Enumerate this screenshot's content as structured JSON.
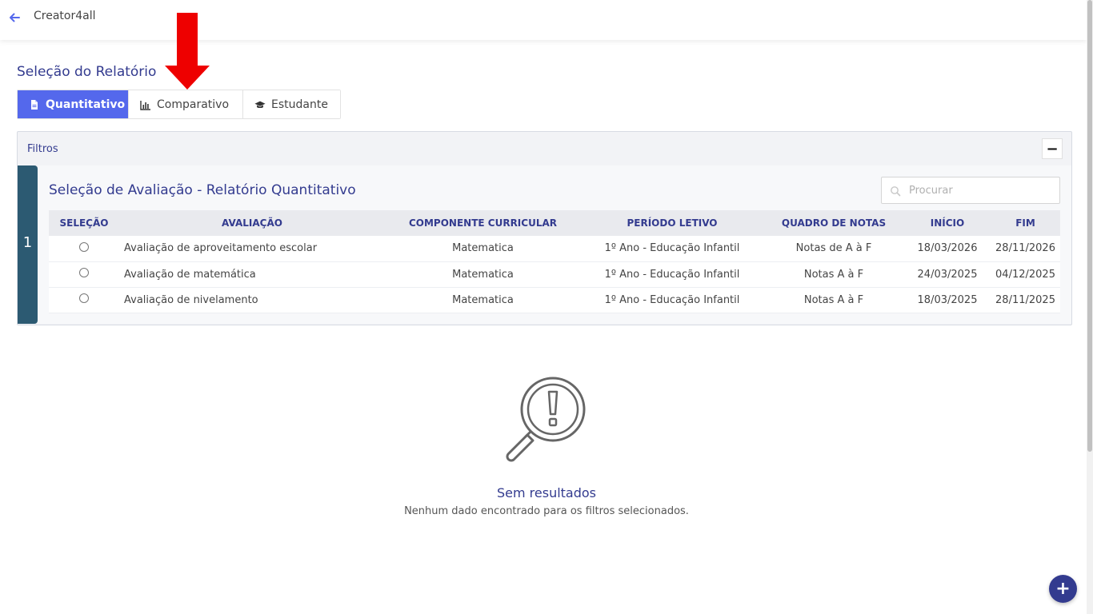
{
  "header": {
    "app_title": "Creator4all",
    "back_icon": "arrow-left-icon"
  },
  "page": {
    "section_title": "Seleção do Relatório"
  },
  "tabs": [
    {
      "label": "Quantitativo",
      "icon": "file-icon",
      "active": true
    },
    {
      "label": "Comparativo",
      "icon": "bar-chart-icon",
      "active": false
    },
    {
      "label": "Estudante",
      "icon": "graduation-cap-icon",
      "active": false
    }
  ],
  "filters": {
    "title": "Filtros",
    "collapse_label": "−",
    "step_number": "1",
    "subtitle": "Seleção de Avaliação - Relatório Quantitativo",
    "search_placeholder": "Procurar",
    "columns": [
      "SELEÇÃO",
      "AVALIAÇÃO",
      "COMPONENTE CURRICULAR",
      "PERÍODO LETIVO",
      "QUADRO DE NOTAS",
      "INÍCIO",
      "FIM"
    ],
    "rows": [
      {
        "avaliacao": "Avaliação de aproveitamento escolar",
        "componente": "Matematica",
        "periodo": "1º Ano - Educação Infantil",
        "quadro": "Notas de A à F",
        "inicio": "18/03/2026",
        "fim": "28/11/2026"
      },
      {
        "avaliacao": "Avaliação de matemática",
        "componente": "Matematica",
        "periodo": "1º Ano - Educação Infantil",
        "quadro": "Notas A à F",
        "inicio": "24/03/2025",
        "fim": "04/12/2025"
      },
      {
        "avaliacao": "Avaliação de nivelamento",
        "componente": "Matematica",
        "periodo": "1º Ano - Educação Infantil",
        "quadro": "Notas A à F",
        "inicio": "18/03/2025",
        "fim": "28/11/2025"
      }
    ]
  },
  "empty_state": {
    "icon": "magnifier-alert-icon",
    "title": "Sem resultados",
    "message": "Nenhum dado encontrado para os filtros selecionados."
  },
  "fab": {
    "label": "+"
  },
  "colors": {
    "primary": "#5468ec",
    "navy": "#333b8f",
    "step_bar": "#2c5a72",
    "annotation_arrow": "#ee0000"
  }
}
